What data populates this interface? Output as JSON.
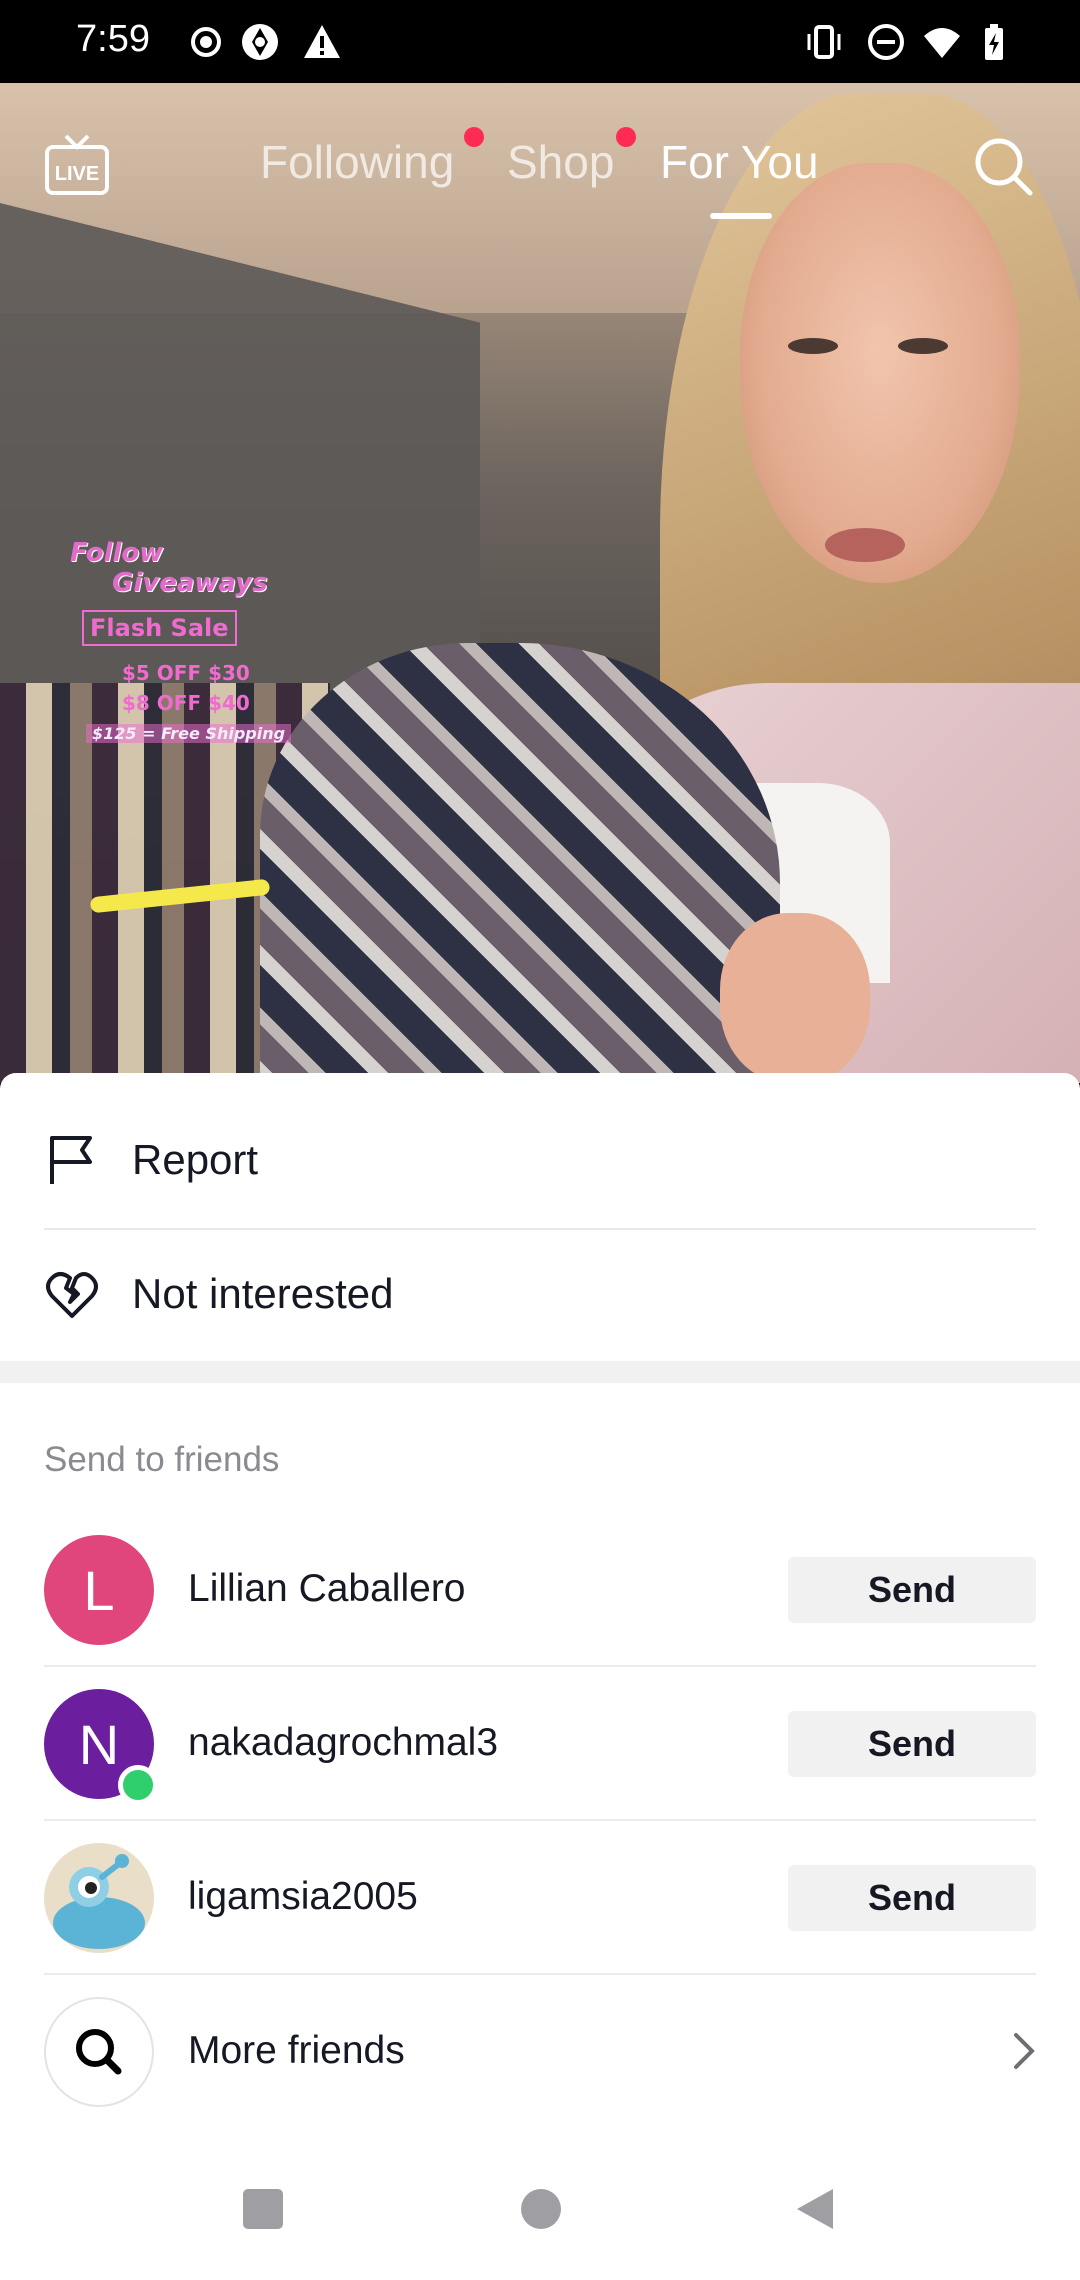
{
  "status_bar": {
    "time": "7:59",
    "left_icons": [
      "record-icon",
      "shutter-icon",
      "warning-icon"
    ],
    "right_icons": [
      "vibrate-icon",
      "do-not-disturb-icon",
      "wifi-icon",
      "battery-charging-icon"
    ]
  },
  "top_nav": {
    "live_label": "LIVE",
    "tabs": [
      {
        "label": "Following",
        "active": false,
        "dot": true
      },
      {
        "label": "Shop",
        "active": false,
        "dot": true
      },
      {
        "label": "For You",
        "active": true,
        "dot": false
      }
    ]
  },
  "video_overlay": {
    "line1": "Follow",
    "line2": "Giveaways",
    "line3": "Flash Sale",
    "line4a": "$5 OFF $30",
    "line4b": "$8 OFF $40",
    "line5": "$125 = Free Shipping"
  },
  "sheet": {
    "menu": [
      {
        "label": "Report",
        "icon": "flag-icon"
      },
      {
        "label": "Not interested",
        "icon": "broken-heart-icon"
      }
    ],
    "section_title": "Send to friends",
    "friends": [
      {
        "name": "Lillian Caballero",
        "initial": "L",
        "avatar_color": "#e0457b",
        "online": false,
        "button": "Send"
      },
      {
        "name": "nakadagrochmal3",
        "initial": "N",
        "avatar_color": "#6b1f9e",
        "online": true,
        "button": "Send"
      },
      {
        "name": "ligamsia2005",
        "initial": "",
        "avatar_color": "#e9dfc8",
        "online": false,
        "button": "Send"
      }
    ],
    "more_friends": "More friends"
  },
  "colors": {
    "accent_red": "#fe2c55",
    "online_green": "#2fcf6d"
  }
}
